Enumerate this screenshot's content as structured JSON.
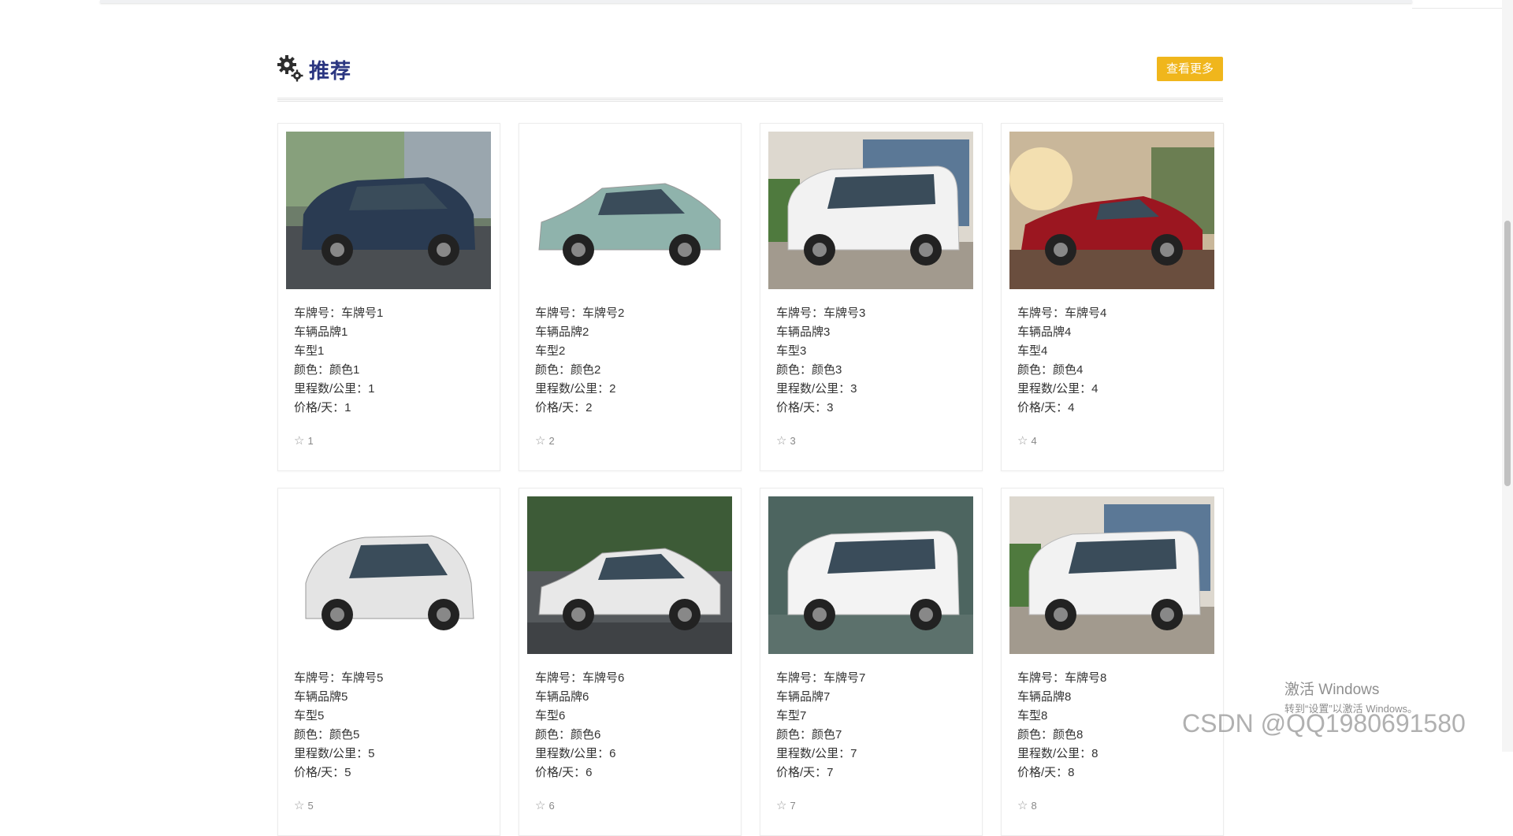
{
  "section": {
    "title": "推荐",
    "more_label": "查看更多"
  },
  "labels": {
    "plate": "车牌号：",
    "color": "颜色：",
    "mileage": "里程数/公里：",
    "price": "价格/天："
  },
  "cars": [
    {
      "plate": "车牌号1",
      "brand": "车辆品牌1",
      "model": "车型1",
      "color": "颜色1",
      "mileage": "1",
      "price": "1",
      "stars": "1",
      "body": "suv",
      "paint": "#2a3b52",
      "bg": "street"
    },
    {
      "plate": "车牌号2",
      "brand": "车辆品牌2",
      "model": "车型2",
      "color": "颜色2",
      "mileage": "2",
      "price": "2",
      "stars": "2",
      "body": "sedan",
      "paint": "#8fb3ac",
      "bg": "white"
    },
    {
      "plate": "车牌号3",
      "brand": "车辆品牌3",
      "model": "车型3",
      "color": "颜色3",
      "mileage": "3",
      "price": "3",
      "stars": "3",
      "body": "van",
      "paint": "#f2f2f2",
      "bg": "garage"
    },
    {
      "plate": "车牌号4",
      "brand": "车辆品牌4",
      "model": "车型4",
      "color": "颜色4",
      "mileage": "4",
      "price": "4",
      "stars": "4",
      "body": "coupe",
      "paint": "#9b1620",
      "bg": "sunset"
    },
    {
      "plate": "车牌号5",
      "brand": "车辆品牌5",
      "model": "车型5",
      "color": "颜色5",
      "mileage": "5",
      "price": "5",
      "stars": "5",
      "body": "hatch",
      "paint": "#e4e4e4",
      "bg": "white"
    },
    {
      "plate": "车牌号6",
      "brand": "车辆品牌6",
      "model": "车型6",
      "color": "颜色6",
      "mileage": "6",
      "price": "6",
      "stars": "6",
      "body": "sedan",
      "paint": "#e8e8e8",
      "bg": "forest"
    },
    {
      "plate": "车牌号7",
      "brand": "车辆品牌7",
      "model": "车型7",
      "color": "颜色7",
      "mileage": "7",
      "price": "7",
      "stars": "7",
      "body": "van",
      "paint": "#f3f3f3",
      "bg": "studio"
    },
    {
      "plate": "车牌号8",
      "brand": "车辆品牌8",
      "model": "车型8",
      "color": "颜色8",
      "mileage": "8",
      "price": "8",
      "stars": "8",
      "body": "van",
      "paint": "#f2f2f2",
      "bg": "garage"
    }
  ],
  "colors": {
    "accent": "#f0b61c",
    "title": "#2a3580"
  },
  "watermark": {
    "title": "激活 Windows",
    "sub": "转到“设置”以激活 Windows。",
    "csdn": "CSDN @QQ1980691580"
  }
}
